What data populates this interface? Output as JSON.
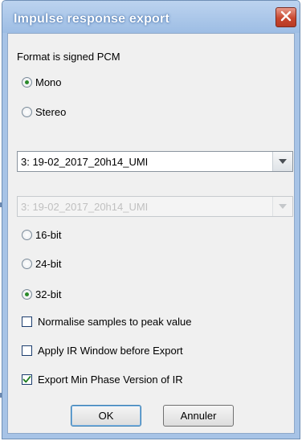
{
  "window": {
    "title": "Impulse response export",
    "close_icon": "close-icon"
  },
  "format": {
    "label": "Format is signed PCM"
  },
  "channels": [
    {
      "label": "Mono",
      "selected": true
    },
    {
      "label": "Stereo",
      "selected": false
    }
  ],
  "combo_primary": {
    "value": "3: 19-02_2017_20h14_UMI",
    "enabled": true
  },
  "combo_secondary": {
    "value": "3: 19-02_2017_20h14_UMI",
    "enabled": false
  },
  "bit_depths": [
    {
      "label": "16-bit",
      "selected": false
    },
    {
      "label": "24-bit",
      "selected": false
    },
    {
      "label": "32-bit",
      "selected": true
    }
  ],
  "options": [
    {
      "label": "Normalise samples to peak value",
      "checked": false
    },
    {
      "label": "Apply IR Window before Export",
      "checked": false
    },
    {
      "label": "Export Min Phase Version of IR",
      "checked": true
    }
  ],
  "buttons": {
    "ok": "OK",
    "cancel": "Annuler"
  },
  "colors": {
    "title_bar": "#a7c3e6",
    "close_button": "#c8472f",
    "client_bg": "#f0f0f0",
    "radio_selected_dot": "#2a8a2a",
    "check_mark": "#1a7a1a"
  }
}
